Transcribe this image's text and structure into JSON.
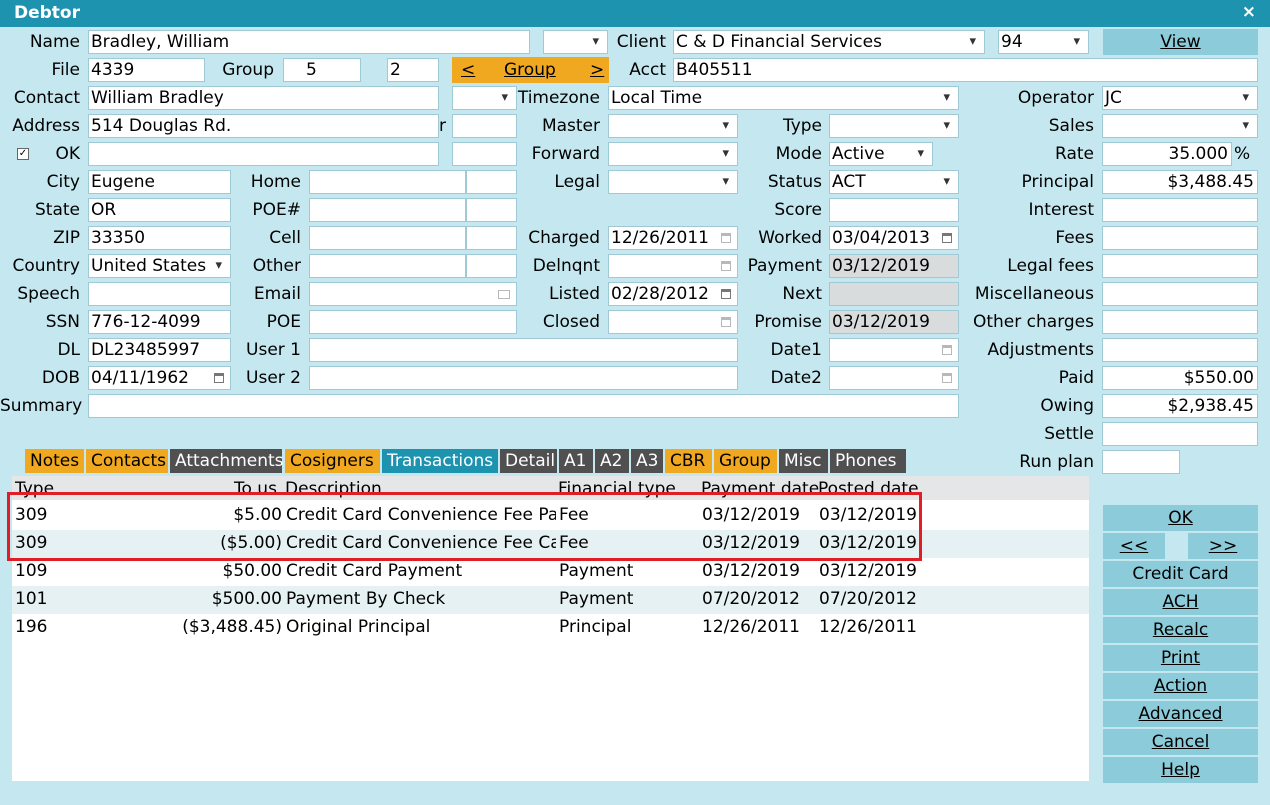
{
  "window": {
    "title": "Debtor",
    "close": "×"
  },
  "left": {
    "name_label": "Name",
    "name": "Bradley, William",
    "file_label": "File",
    "file": "4339",
    "group_label": "Group",
    "group": "5",
    "group2": "2",
    "contact_label": "Contact",
    "contact": "William Bradley",
    "address_label": "Address",
    "address": "514 Douglas Rd.",
    "address_trail": "r",
    "ok_label": "OK",
    "ok_checked": "✓",
    "city_label": "City",
    "city": "Eugene",
    "state_label": "State",
    "state": "OR",
    "zip_label": "ZIP",
    "zip": "33350",
    "country_label": "Country",
    "country": "United States",
    "speech_label": "Speech",
    "speech": "",
    "ssn_label": "SSN",
    "ssn": "776-12-4099",
    "dl_label": "DL",
    "dl": "DL23485997",
    "dob_label": "DOB",
    "dob": "04/11/1962",
    "summary_label": "Summary",
    "summary": ""
  },
  "phones": {
    "home_label": "Home",
    "poe_num_label": "POE#",
    "cell_label": "Cell",
    "other_label": "Other",
    "email_label": "Email",
    "poe_label": "POE",
    "user1_label": "User 1",
    "user2_label": "User 2"
  },
  "client": {
    "client_label": "Client",
    "client": "C & D Financial Services",
    "client_code": "94",
    "group_button": "Group",
    "group_prev": "<",
    "group_next": ">",
    "acct_label": "Acct",
    "acct": "B405511",
    "timezone_label": "Timezone",
    "timezone": "Local Time",
    "master_label": "Master",
    "forward_label": "Forward",
    "legal_label": "Legal",
    "charged_label": "Charged",
    "charged": "12/26/2011",
    "delnqnt_label": "Delnqnt",
    "delnqnt": "",
    "listed_label": "Listed",
    "listed": "02/28/2012",
    "closed_label": "Closed",
    "closed": ""
  },
  "status": {
    "type_label": "Type",
    "mode_label": "Mode",
    "mode": "Active",
    "status_label": "Status",
    "status": "ACT",
    "score_label": "Score",
    "score": "",
    "worked_label": "Worked",
    "worked": "03/04/2013",
    "payment_label": "Payment",
    "payment": "03/12/2019",
    "next_label": "Next",
    "next": "",
    "promise_label": "Promise",
    "promise": "03/12/2019",
    "date1_label": "Date1",
    "date2_label": "Date2"
  },
  "amounts": {
    "operator_label": "Operator",
    "operator": "JC",
    "sales_label": "Sales",
    "sales": "",
    "rate_label": "Rate",
    "rate": "35.000",
    "rate_unit": "%",
    "principal_label": "Principal",
    "principal": "$3,488.45",
    "interest_label": "Interest",
    "interest": "",
    "fees_label": "Fees",
    "fees": "",
    "legal_fees_label": "Legal fees",
    "legal_fees": "",
    "misc_label": "Miscellaneous",
    "misc": "",
    "other_label": "Other charges",
    "other": "",
    "adj_label": "Adjustments",
    "adj": "",
    "paid_label": "Paid",
    "paid": "$550.00",
    "owing_label": "Owing",
    "owing": "$2,938.45",
    "settle_label": "Settle",
    "settle": "",
    "runplan_label": "Run plan",
    "runplan": ""
  },
  "view_button": "View",
  "tabs": [
    "Notes",
    "Contacts",
    "Attachments",
    "Cosigners",
    "Transactions",
    "Detail",
    "A1",
    "A2",
    "A3",
    "CBR",
    "Group",
    "Misc",
    "Phones"
  ],
  "table": {
    "headers": [
      "Type",
      "To us",
      "Description",
      "Financial type",
      "Payment date",
      "Posted date"
    ],
    "rows": [
      [
        "309",
        "$5.00",
        "Credit Card Convenience Fee Pa",
        "Fee",
        "03/12/2019",
        "03/12/2019"
      ],
      [
        "309",
        "($5.00)",
        "Credit Card Convenience Fee Ca",
        "Fee",
        "03/12/2019",
        "03/12/2019"
      ],
      [
        "109",
        "$50.00",
        "Credit Card Payment",
        "Payment",
        "03/12/2019",
        "03/12/2019"
      ],
      [
        "101",
        "$500.00",
        "Payment By Check",
        "Payment",
        "07/20/2012",
        "07/20/2012"
      ],
      [
        "196",
        "($3,488.45)",
        "Original Principal",
        "Principal",
        "12/26/2011",
        "12/26/2011"
      ]
    ]
  },
  "side_buttons": {
    "ok": "OK",
    "prev": "<<",
    "next": ">>",
    "credit_card": "Credit Card",
    "ach": "ACH",
    "recalc": "Recalc",
    "print": "Print",
    "action": "Action",
    "advanced": "Advanced",
    "cancel": "Cancel",
    "help": "Help"
  },
  "colors": {
    "title_bar": "#1e93b0",
    "background": "#c5e8f0",
    "tab_orange": "#f0a820",
    "tab_gray": "#505050",
    "button": "#8ccbd9",
    "highlight": "#e01e26"
  }
}
